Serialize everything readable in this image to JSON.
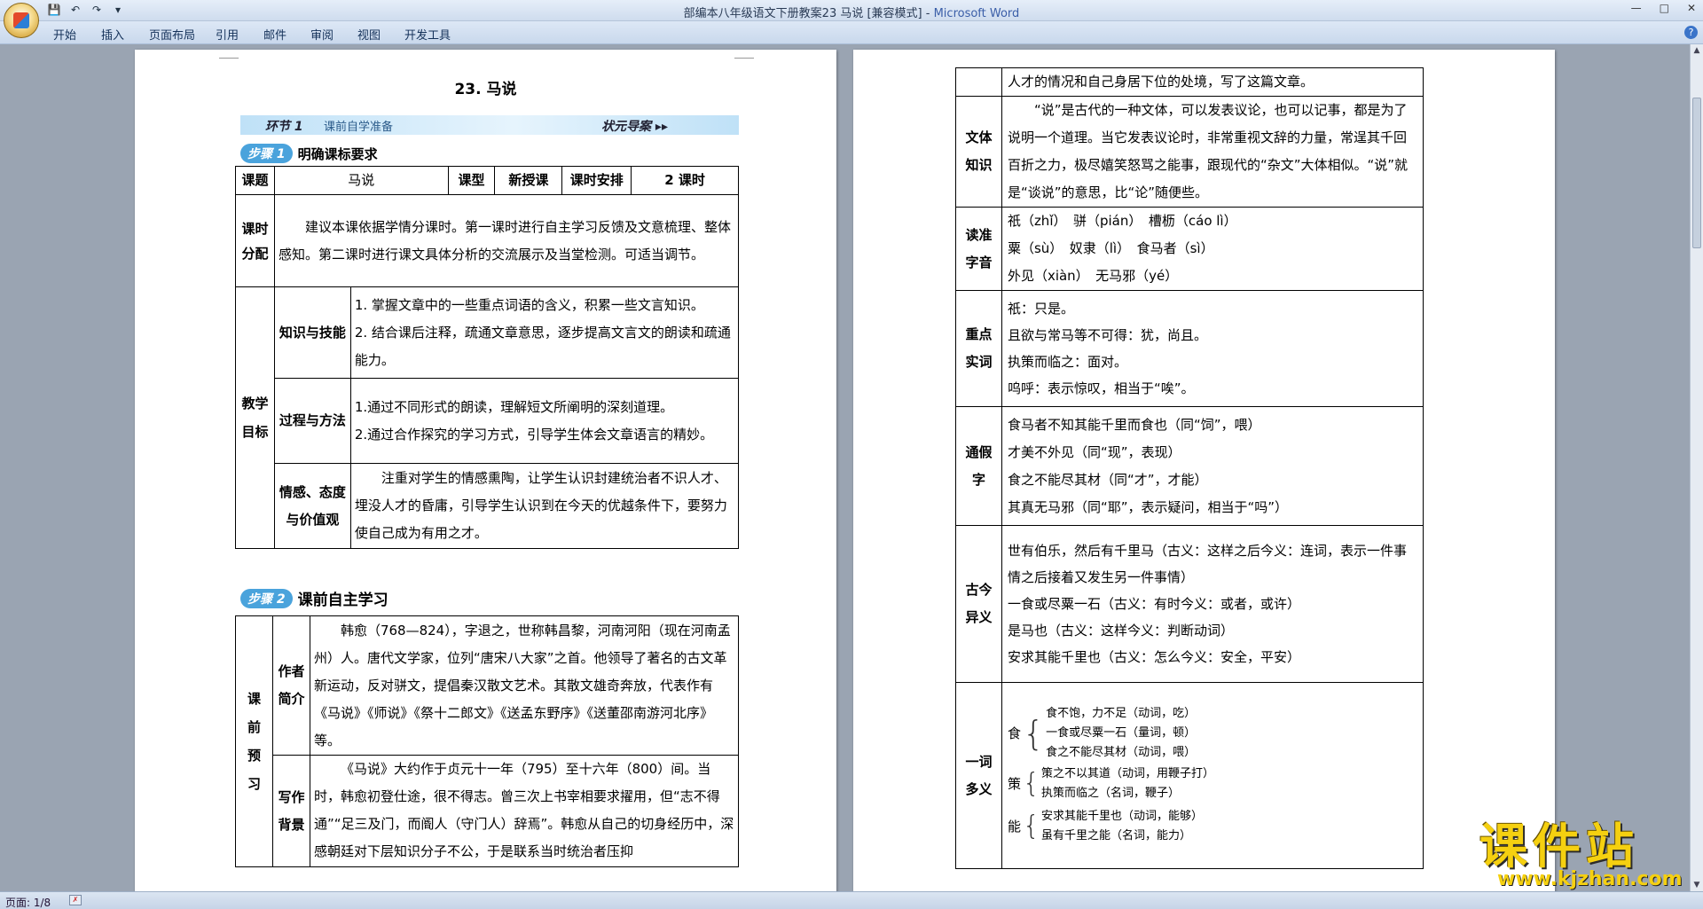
{
  "window": {
    "title": "部编本八年级语文下册教案23 马说 [兼容模式]",
    "app_name": "Microsoft Word",
    "separator": " - "
  },
  "ribbon_tabs": [
    "开始",
    "插入",
    "页面布局",
    "引用",
    "邮件",
    "审阅",
    "视图",
    "开发工具"
  ],
  "status": {
    "page": "页面: 1/8"
  },
  "watermark": {
    "main": "课件站",
    "url": "www.kjzhan.com"
  },
  "left_page": {
    "title": "23. 马说",
    "band": {
      "section": "环节",
      "num": "1",
      "label": "课前自学准备",
      "brand": "状元",
      "guide": "导案"
    },
    "step1": {
      "label": "步骤",
      "num": "1",
      "text": "明确课标要求"
    },
    "step2": {
      "label": "步骤",
      "num": "2",
      "text": "课前自主学习"
    },
    "table1": {
      "row1": [
        "课题",
        "马说",
        "课型",
        "新授课",
        "课时安排",
        "2 课时"
      ],
      "fenpei_head": "课时分配",
      "fenpei": "建议本课依据学情分课时。第一课时进行自主学习反馈及文意梳理、整体感知。第二课时进行课文具体分析的交流展示及当堂检测。可适当调节。",
      "goals_head": "教学目标",
      "goals": [
        {
          "head": "知识与技能",
          "lines": [
            "1. 掌握文章中的一些重点词语的含义，积累一些文言知识。",
            "2. 结合课后注释，疏通文章意思，逐步提高文言文的朗读和疏通能力。"
          ]
        },
        {
          "head": "过程与方法",
          "lines": [
            "1.通过不同形式的朗读，理解短文所阐明的深刻道理。",
            "2.通过合作探究的学习方式，引导学生体会文章语言的精妙。"
          ]
        },
        {
          "head": "情感、态度与价值观",
          "lines": [
            "注重对学生的情感熏陶，让学生认识封建统治者不识人才、埋没人才的昏庸，引导学生认识到在今天的优越条件下，要努力使自己成为有用之才。"
          ]
        }
      ]
    },
    "table2": {
      "head": "课前预习",
      "author_head": "作者简介",
      "author": "韩愈（768—824），字退之，世称韩昌黎，河南河阳（现在河南孟州）人。唐代文学家，位列“唐宋八大家”之首。他领导了著名的古文革新运动，反对骈文，提倡秦汉散文艺术。其散文雄奇奔放，代表作有《马说》《师说》《祭十二郎文》《送孟东野序》《送董邵南游河北序》等。",
      "bg_head": "写作背景",
      "bg": "《马说》大约作于贞元十一年（795）至十六年（800）间。当时，韩愈初登仕途，很不得志。曾三次上书宰相要求擢用，但“志不得通”“足三及门，而阍人（守门人）辞焉”。韩愈从自己的切身经历中，深感朝廷对下层知识分子不公，于是联系当时统治者压抑"
    }
  },
  "right_page": {
    "top_line": "人才的情况和自己身居下位的处境，写了这篇文章。",
    "wenti": {
      "head": "文体知识",
      "text": "“说”是古代的一种文体，可以发表议论，也可以记事，都是为了说明一个道理。当它发表议论时，非常重视文辞的力量，常逞其千回百折之力，极尽嬉笑怒骂之能事，跟现代的“杂文”大体相似。“说”就是“谈说”的意思，比“论”随便些。"
    },
    "duzhun": {
      "head": "读准字音",
      "lines": [
        "祇（zhǐ）　骈（pián）　槽枥（cáo lì）",
        "粟（sù）　奴隶（lì）　食马者（sì）",
        "外见（xiàn）　无马邪（yé）"
      ]
    },
    "shici": {
      "head": "重点实词",
      "lines": [
        "祇：只是。",
        "且欲与常马等不可得：犹，尚且。",
        "执策而临之：面对。",
        "呜呼：表示惊叹，相当于“唉”。"
      ]
    },
    "tongjia": {
      "head": "通假字",
      "lines": [
        "食马者不知其能千里而食也（同“饲”，喂）",
        "才美不外见（同“现”，表现）",
        "食之不能尽其材（同“才”，才能）",
        "其真无马邪（同“耶”，表示疑问，相当于“吗”）"
      ]
    },
    "gujin": {
      "head": "古今异义",
      "lines": [
        "世有伯乐，然后有千里马（古义：这样之后今义：连词，表示一件事情之后接着又发生另一件事情）",
        "一食或尽粟一石（古义：有时今义：或者，或许）",
        "是马也（古义：这样今义：判断动词）",
        "安求其能千里也（古义：怎么今义：安全，平安）"
      ]
    },
    "duoyi": {
      "head": "一词多义",
      "groups": [
        {
          "word": "食",
          "lines": [
            "食不饱，力不足（动词，吃）",
            "一食或尽粟一石（量词，顿）",
            "食之不能尽其材（动词，喂）"
          ]
        },
        {
          "word": "策",
          "lines": [
            "策之不以其道（动词，用鞭子打）",
            "执策而临之（名词，鞭子）"
          ]
        },
        {
          "word": "能",
          "lines": [
            "安求其能千里也（动词，能够）",
            "虽有千里之能（名词，能力）"
          ]
        }
      ]
    }
  }
}
